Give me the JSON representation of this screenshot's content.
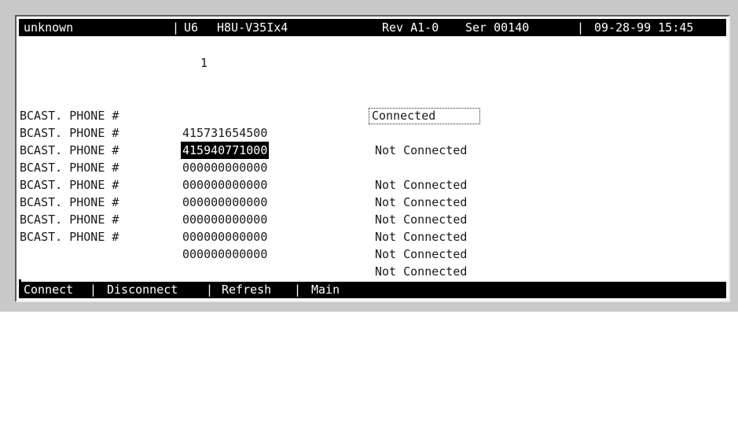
{
  "header": {
    "system_name": "unknown",
    "sep1": "|",
    "unit": "U6",
    "model": "H8U-V35Ix4",
    "revision": "Rev A1-0",
    "serial": "Ser 00140",
    "sep2": "|",
    "datetime": "09-28-99 15:45"
  },
  "page_number": "1",
  "rows": [
    {
      "label": "BCAST. PHONE #",
      "phone": "415731654500",
      "status": "Not Connected"
    },
    {
      "label": "BCAST. PHONE #",
      "phone": "415940771000",
      "status": "Connected"
    },
    {
      "label": "BCAST. PHONE #",
      "phone": "000000000000",
      "status": "Not Connected"
    },
    {
      "label": "BCAST. PHONE #",
      "phone": "000000000000",
      "status": "Not Connected"
    },
    {
      "label": "BCAST. PHONE #",
      "phone": "000000000000",
      "status": "Not Connected"
    },
    {
      "label": "BCAST. PHONE #",
      "phone": "000000000000",
      "status": "Not Connected"
    },
    {
      "label": "BCAST. PHONE #",
      "phone": "000000000000",
      "status": "Not Connected"
    },
    {
      "label": "BCAST. PHONE #",
      "phone": "000000000000",
      "status": "Not Connected"
    }
  ],
  "menu": {
    "connect": "Connect",
    "sep": "|",
    "disconnect": "Disconnect",
    "refresh": "Refresh",
    "main": "Main"
  }
}
